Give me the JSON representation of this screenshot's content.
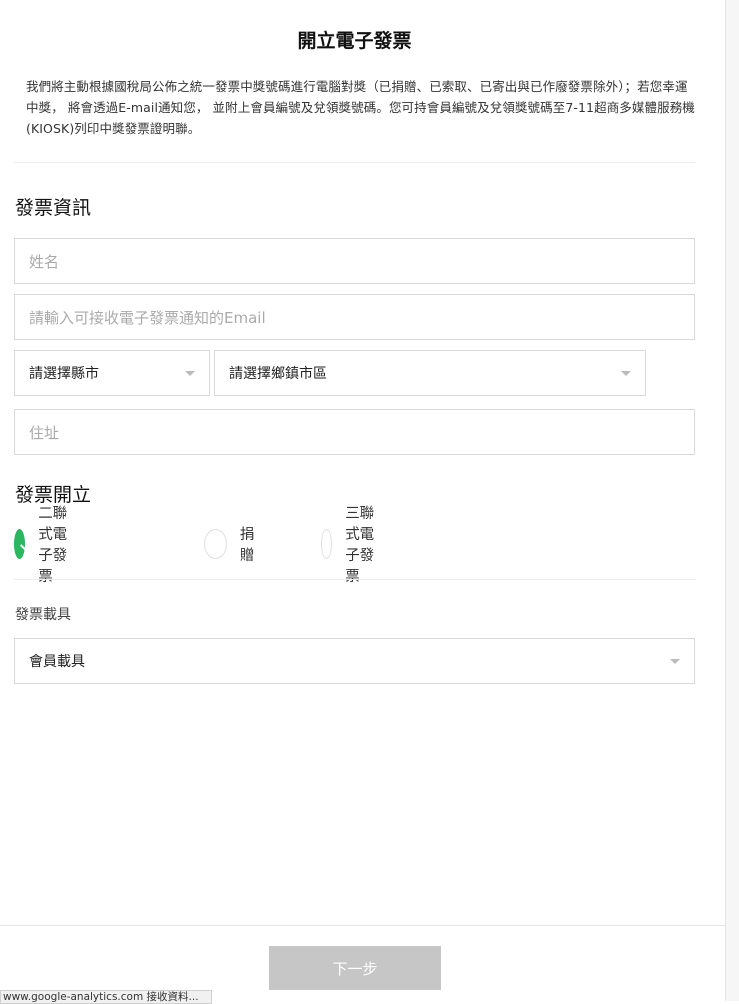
{
  "page": {
    "title": "開立電子發票",
    "notice": "我們將主動根據國稅局公佈之統一發票中獎號碼進行電腦對獎（已捐贈、已索取、已寄出與已作廢發票除外）；若您幸運中獎， 將會透過E-mail通知您， 並附上會員編號及兌領獎號碼。您可持會員編號及兌領獎號碼至7-11超商多媒體服務機(KIOSK)列印中獎發票證明聯。"
  },
  "invoice_info": {
    "heading": "發票資訊",
    "name_placeholder": "姓名",
    "email_placeholder": "請輸入可接收電子發票通知的Email",
    "county_select": "請選擇縣市",
    "district_select": "請選擇鄉鎮市區",
    "address_placeholder": "住址"
  },
  "invoice_issue": {
    "heading": "發票開立",
    "options": [
      {
        "label": "二聯式電子發票",
        "checked": true
      },
      {
        "label": "捐贈",
        "checked": false
      },
      {
        "label": "三聯式電子發票",
        "checked": false
      }
    ],
    "carrier_label": "發票載具",
    "carrier_value": "會員載具"
  },
  "footer": {
    "next_button": "下一步",
    "status_text": "www.google-analytics.com 接收資料..."
  },
  "colors": {
    "accent_green": "#2bb660",
    "disabled_button": "#c6c6c6"
  }
}
